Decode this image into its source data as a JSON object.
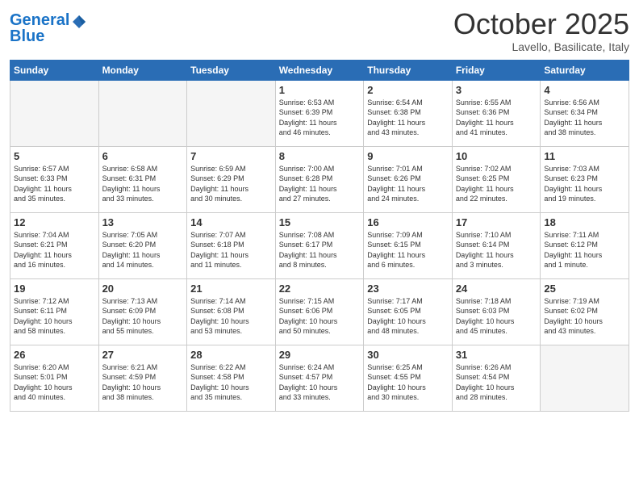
{
  "header": {
    "logo_line1": "General",
    "logo_line2": "Blue",
    "month": "October 2025",
    "location": "Lavello, Basilicate, Italy"
  },
  "weekdays": [
    "Sunday",
    "Monday",
    "Tuesday",
    "Wednesday",
    "Thursday",
    "Friday",
    "Saturday"
  ],
  "weeks": [
    [
      {
        "num": "",
        "info": ""
      },
      {
        "num": "",
        "info": ""
      },
      {
        "num": "",
        "info": ""
      },
      {
        "num": "1",
        "info": "Sunrise: 6:53 AM\nSunset: 6:39 PM\nDaylight: 11 hours\nand 46 minutes."
      },
      {
        "num": "2",
        "info": "Sunrise: 6:54 AM\nSunset: 6:38 PM\nDaylight: 11 hours\nand 43 minutes."
      },
      {
        "num": "3",
        "info": "Sunrise: 6:55 AM\nSunset: 6:36 PM\nDaylight: 11 hours\nand 41 minutes."
      },
      {
        "num": "4",
        "info": "Sunrise: 6:56 AM\nSunset: 6:34 PM\nDaylight: 11 hours\nand 38 minutes."
      }
    ],
    [
      {
        "num": "5",
        "info": "Sunrise: 6:57 AM\nSunset: 6:33 PM\nDaylight: 11 hours\nand 35 minutes."
      },
      {
        "num": "6",
        "info": "Sunrise: 6:58 AM\nSunset: 6:31 PM\nDaylight: 11 hours\nand 33 minutes."
      },
      {
        "num": "7",
        "info": "Sunrise: 6:59 AM\nSunset: 6:29 PM\nDaylight: 11 hours\nand 30 minutes."
      },
      {
        "num": "8",
        "info": "Sunrise: 7:00 AM\nSunset: 6:28 PM\nDaylight: 11 hours\nand 27 minutes."
      },
      {
        "num": "9",
        "info": "Sunrise: 7:01 AM\nSunset: 6:26 PM\nDaylight: 11 hours\nand 24 minutes."
      },
      {
        "num": "10",
        "info": "Sunrise: 7:02 AM\nSunset: 6:25 PM\nDaylight: 11 hours\nand 22 minutes."
      },
      {
        "num": "11",
        "info": "Sunrise: 7:03 AM\nSunset: 6:23 PM\nDaylight: 11 hours\nand 19 minutes."
      }
    ],
    [
      {
        "num": "12",
        "info": "Sunrise: 7:04 AM\nSunset: 6:21 PM\nDaylight: 11 hours\nand 16 minutes."
      },
      {
        "num": "13",
        "info": "Sunrise: 7:05 AM\nSunset: 6:20 PM\nDaylight: 11 hours\nand 14 minutes."
      },
      {
        "num": "14",
        "info": "Sunrise: 7:07 AM\nSunset: 6:18 PM\nDaylight: 11 hours\nand 11 minutes."
      },
      {
        "num": "15",
        "info": "Sunrise: 7:08 AM\nSunset: 6:17 PM\nDaylight: 11 hours\nand 8 minutes."
      },
      {
        "num": "16",
        "info": "Sunrise: 7:09 AM\nSunset: 6:15 PM\nDaylight: 11 hours\nand 6 minutes."
      },
      {
        "num": "17",
        "info": "Sunrise: 7:10 AM\nSunset: 6:14 PM\nDaylight: 11 hours\nand 3 minutes."
      },
      {
        "num": "18",
        "info": "Sunrise: 7:11 AM\nSunset: 6:12 PM\nDaylight: 11 hours\nand 1 minute."
      }
    ],
    [
      {
        "num": "19",
        "info": "Sunrise: 7:12 AM\nSunset: 6:11 PM\nDaylight: 10 hours\nand 58 minutes."
      },
      {
        "num": "20",
        "info": "Sunrise: 7:13 AM\nSunset: 6:09 PM\nDaylight: 10 hours\nand 55 minutes."
      },
      {
        "num": "21",
        "info": "Sunrise: 7:14 AM\nSunset: 6:08 PM\nDaylight: 10 hours\nand 53 minutes."
      },
      {
        "num": "22",
        "info": "Sunrise: 7:15 AM\nSunset: 6:06 PM\nDaylight: 10 hours\nand 50 minutes."
      },
      {
        "num": "23",
        "info": "Sunrise: 7:17 AM\nSunset: 6:05 PM\nDaylight: 10 hours\nand 48 minutes."
      },
      {
        "num": "24",
        "info": "Sunrise: 7:18 AM\nSunset: 6:03 PM\nDaylight: 10 hours\nand 45 minutes."
      },
      {
        "num": "25",
        "info": "Sunrise: 7:19 AM\nSunset: 6:02 PM\nDaylight: 10 hours\nand 43 minutes."
      }
    ],
    [
      {
        "num": "26",
        "info": "Sunrise: 6:20 AM\nSunset: 5:01 PM\nDaylight: 10 hours\nand 40 minutes."
      },
      {
        "num": "27",
        "info": "Sunrise: 6:21 AM\nSunset: 4:59 PM\nDaylight: 10 hours\nand 38 minutes."
      },
      {
        "num": "28",
        "info": "Sunrise: 6:22 AM\nSunset: 4:58 PM\nDaylight: 10 hours\nand 35 minutes."
      },
      {
        "num": "29",
        "info": "Sunrise: 6:24 AM\nSunset: 4:57 PM\nDaylight: 10 hours\nand 33 minutes."
      },
      {
        "num": "30",
        "info": "Sunrise: 6:25 AM\nSunset: 4:55 PM\nDaylight: 10 hours\nand 30 minutes."
      },
      {
        "num": "31",
        "info": "Sunrise: 6:26 AM\nSunset: 4:54 PM\nDaylight: 10 hours\nand 28 minutes."
      },
      {
        "num": "",
        "info": ""
      }
    ]
  ]
}
